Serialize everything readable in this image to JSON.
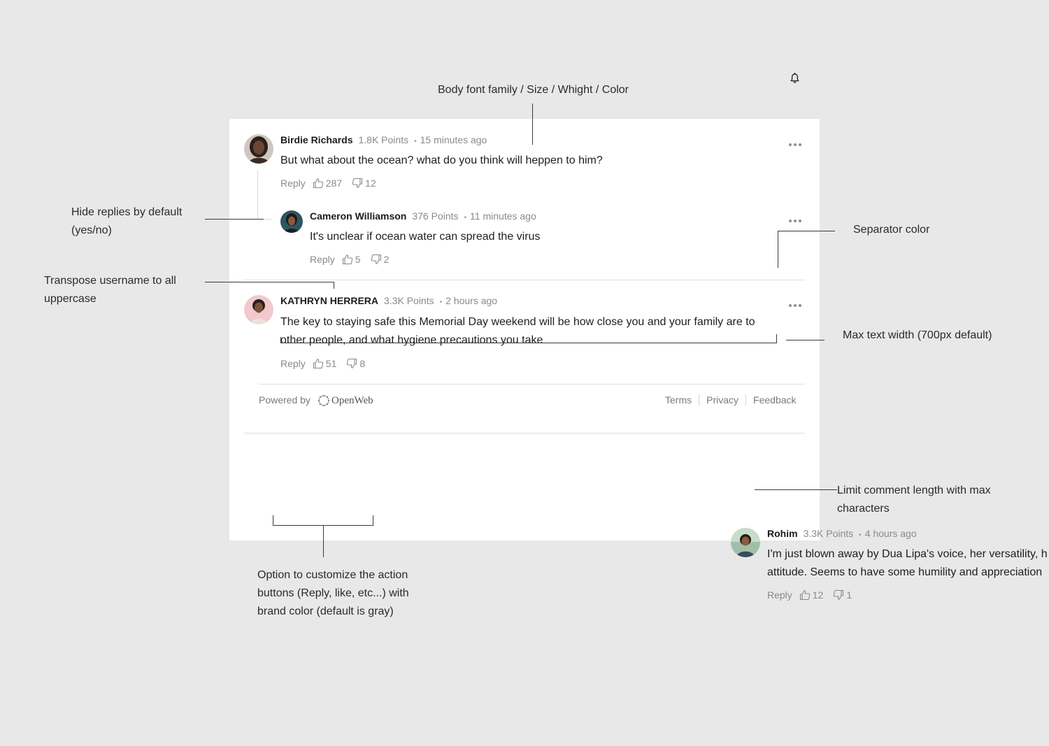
{
  "colors": {
    "background": "#e8e8e8",
    "card": "#ffffff",
    "separator": "#e0e0e0",
    "muted_text": "#8a8a8a",
    "annotation_line": "#3a3a3a"
  },
  "header": {
    "icon": "bell-icon"
  },
  "annotations": {
    "body_font": "Body font family / Size / Whight / Color",
    "hide_replies_1": "Hide replies by default",
    "hide_replies_2": "(yes/no)",
    "separator_color": "Separator color",
    "transpose_1": "Transpose username to all",
    "transpose_2": "uppercase",
    "max_width": "Max text width (700px default)",
    "limit_length_1": "Limit comment length with max",
    "limit_length_2": "characters",
    "action_buttons_1": "Option to customize the action",
    "action_buttons_2": "buttons (Reply, like, etc...) with",
    "action_buttons_3": "brand color (default is gray)"
  },
  "comments": [
    {
      "username": "Birdie Richards",
      "points": "1.8K Points",
      "time": "15 minutes ago",
      "text": "But what about the ocean? what do you think will heppen to him?",
      "reply": "Reply",
      "likes": "287",
      "dislikes": "12",
      "reply_item": {
        "username": "Cameron Williamson",
        "points": "376 Points",
        "time": "11 minutes ago",
        "text": "It's unclear if ocean water can spread the virus",
        "reply": "Reply",
        "likes": "5",
        "dislikes": "2"
      }
    },
    {
      "username": "KATHRYN HERRERA",
      "points": "3.3K Points",
      "time": "2 hours ago",
      "text_line1": "The key to staying safe this Memorial Day weekend will be how close you and your family are to",
      "text_line2": "other people, and what hygiene precautions you take",
      "reply": "Reply",
      "likes": "51",
      "dislikes": "8"
    }
  ],
  "footer": {
    "powered_by": "Powered by",
    "brand": "OpenWeb",
    "links": [
      "Terms",
      "Privacy",
      "Feedback"
    ]
  },
  "example_comment": {
    "username": "Rohim",
    "points": "3.3K Points",
    "time": "4 hours ago",
    "text_line1": "I'm just blown away by Dua Lipa's voice, her versatility, h",
    "text_line2": "attitude. Seems to have some humility and appreciation",
    "reply": "Reply",
    "likes": "12",
    "dislikes": "1"
  },
  "dot_separator": "•"
}
